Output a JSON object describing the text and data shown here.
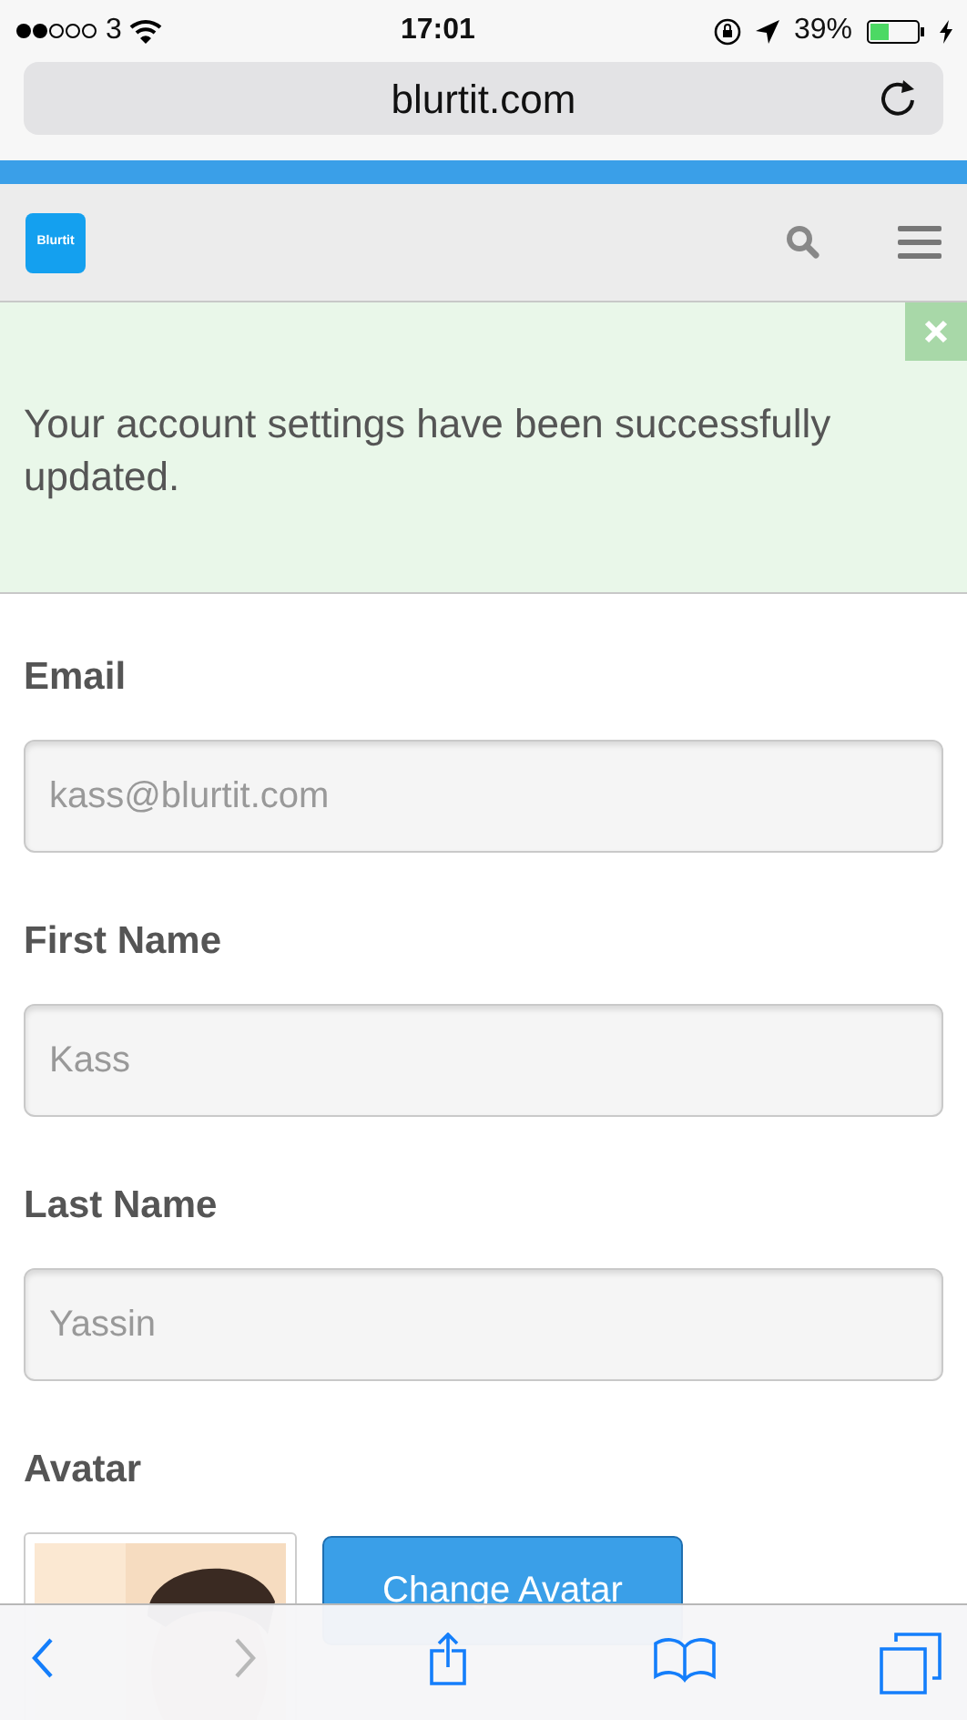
{
  "status_bar": {
    "carrier": "3",
    "time": "17:01",
    "battery": "39%"
  },
  "address_bar": {
    "url": "blurtit.com"
  },
  "site_header": {
    "logo": "Blurtit"
  },
  "alert": {
    "message": "Your account settings have been successfully updated."
  },
  "form": {
    "fields": [
      {
        "label": "Email",
        "placeholder": "kass@blurtit.com"
      },
      {
        "label": "First Name",
        "placeholder": "Kass"
      },
      {
        "label": "Last Name",
        "placeholder": "Yassin"
      }
    ],
    "avatar": {
      "label": "Avatar",
      "button": "Change Avatar"
    }
  },
  "toolbar": {
    "buttons": [
      {
        "kind": "back",
        "disabled": false
      },
      {
        "kind": "forward",
        "disabled": true
      },
      {
        "kind": "share",
        "disabled": false
      },
      {
        "kind": "bookmarks",
        "disabled": false
      },
      {
        "kind": "tabs",
        "disabled": false
      }
    ]
  }
}
